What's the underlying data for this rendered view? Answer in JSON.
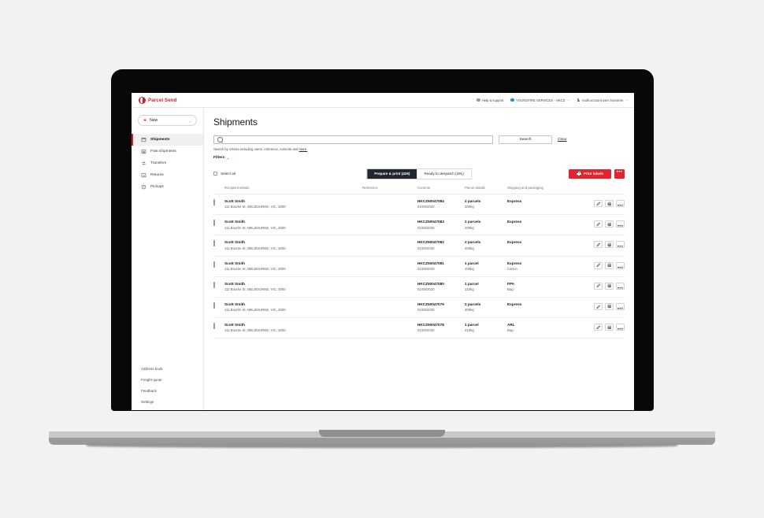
{
  "brand": {
    "name": "Parcel Send",
    "logo_icon": "parcel-send-logo-icon",
    "accent": "#dc1928"
  },
  "topbar": {
    "help": {
      "label": "Help & support",
      "icon": "help-circle-icon"
    },
    "account": {
      "label": "YOUNGFIRE SERVICES - HKCZ",
      "icon": "account-dot-icon",
      "caret": "⌄",
      "color": "#1c94c4"
    },
    "user": {
      "label": "multi account user Surname",
      "icon": "person-icon",
      "caret": "⌄"
    }
  },
  "sidebar": {
    "new_button": {
      "label": "New",
      "plus": "+",
      "caret": "⌄"
    },
    "items": [
      {
        "label": "Shipments",
        "icon": "shipments-icon",
        "active": true
      },
      {
        "label": "Past shipments",
        "icon": "past-shipments-icon",
        "active": false
      },
      {
        "label": "Transfers",
        "icon": "transfers-icon",
        "active": false
      },
      {
        "label": "Returns",
        "icon": "returns-icon",
        "active": false
      },
      {
        "label": "Pickups",
        "icon": "clock-icon",
        "active": false
      }
    ],
    "footer_links": [
      {
        "label": "Address book"
      },
      {
        "label": "Freight quote"
      },
      {
        "label": "Feedback"
      },
      {
        "label": "Settings"
      }
    ]
  },
  "main": {
    "page_title": "Shipments",
    "search": {
      "value": "",
      "placeholder": "",
      "icon": "search-icon",
      "search_button": "Search",
      "clear_link": "Clear",
      "hint_text": "Search by criteria including name, reference, connote and ",
      "hint_link": "more."
    },
    "filters": {
      "label": "Filters",
      "caret": "⌄"
    },
    "toolbar": {
      "select_all": "Select all",
      "print_labels": "Print labels",
      "print_icon": "printer-icon",
      "more_actions": "•••"
    },
    "tabs": [
      {
        "label": "Prepare & print (426)",
        "active": true
      },
      {
        "label": "Ready to despatch (291)",
        "active": false
      }
    ],
    "table": {
      "columns": [
        "Recipient details",
        "Reference",
        "Connote",
        "Parcel details",
        "Shipping and packaging"
      ],
      "row_actions": [
        {
          "name": "edit-button",
          "icon": "pencil-icon"
        },
        {
          "name": "print-button",
          "icon": "printer-icon"
        },
        {
          "name": "more-button",
          "icon": "ellipsis-icon"
        }
      ],
      "rows": [
        {
          "name": "Scott Smith",
          "address": "111 Bourke St, MELBOURNE, VIC, 3000",
          "reference": "",
          "connote": "HKCZ50047084",
          "date": "01/09/2020",
          "parcels": "2 parcels",
          "weight": "200kg",
          "service": "Express",
          "packaging": ""
        },
        {
          "name": "Scott Smith",
          "address": "111 Bourke St, MELBOURNE, VIC, 3000",
          "reference": "",
          "connote": "HKCZ50047083",
          "date": "01/09/2020",
          "parcels": "2 parcels",
          "weight": "200kg",
          "service": "Express",
          "packaging": ""
        },
        {
          "name": "Scott Smith",
          "address": "111 Bourke St, MELBOURNE, VIC, 3000",
          "reference": "",
          "connote": "HKCZ50047082",
          "date": "01/09/2020",
          "parcels": "2 parcels",
          "weight": "200kg",
          "service": "Express",
          "packaging": ""
        },
        {
          "name": "Scott Smith",
          "address": "111 Bourke St, MELBOURNE, VIC, 3000",
          "reference": "",
          "connote": "HKCZ50047081",
          "date": "01/09/2020",
          "parcels": "1 parcel",
          "weight": "100kg",
          "service": "Express",
          "packaging": "Carton"
        },
        {
          "name": "Scott Smith",
          "address": "111 Bourke St, MELBOURNE, VIC, 3000",
          "reference": "",
          "connote": "HKCZ50047080",
          "date": "01/09/2020",
          "parcels": "1 parcel",
          "weight": "210kg",
          "service": "FPA",
          "packaging": "Bag"
        },
        {
          "name": "Scott Smith",
          "address": "111 Bourke St, MELBOURNE, VIC, 3000",
          "reference": "",
          "connote": "HKCZ50047079",
          "date": "01/09/2020",
          "parcels": "2 parcels",
          "weight": "300kg",
          "service": "Express",
          "packaging": ""
        },
        {
          "name": "Scott Smith",
          "address": "111 Bourke St, MELBOURNE, VIC, 3000",
          "reference": "",
          "connote": "HKCZ50047078",
          "date": "01/09/2020",
          "parcels": "1 parcel",
          "weight": "210kg",
          "service": "ARL",
          "packaging": "Bag"
        }
      ]
    }
  }
}
